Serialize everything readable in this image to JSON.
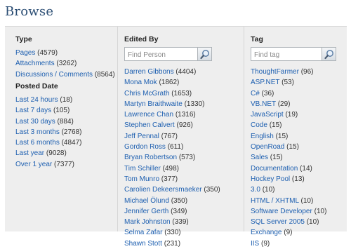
{
  "page": {
    "title": "Browse"
  },
  "type_section": {
    "header": "Type",
    "items": [
      {
        "label": "Pages",
        "count": "(4579)"
      },
      {
        "label": "Attachments",
        "count": "(3262)"
      },
      {
        "label": "Discussions / Comments",
        "count": "(8564)"
      }
    ]
  },
  "posted_date_section": {
    "header": "Posted Date",
    "items": [
      {
        "label": "Last 24 hours",
        "count": "(18)"
      },
      {
        "label": "Last 7 days",
        "count": "(105)"
      },
      {
        "label": "Last 30 days",
        "count": "(884)"
      },
      {
        "label": "Last 3 months",
        "count": "(2768)"
      },
      {
        "label": "Last 6 months",
        "count": "(4847)"
      },
      {
        "label": "Last year",
        "count": "(9028)"
      },
      {
        "label": "Over 1 year",
        "count": "(7377)"
      }
    ]
  },
  "edited_by_section": {
    "header": "Edited By",
    "search": {
      "placeholder": "Find Person",
      "button_icon": "magnifier-icon"
    },
    "items": [
      {
        "label": "Darren Gibbons",
        "count": "(4404)"
      },
      {
        "label": "Mona Mok",
        "count": "(1862)"
      },
      {
        "label": "Chris McGrath",
        "count": "(1653)"
      },
      {
        "label": "Martyn Braithwaite",
        "count": "(1330)"
      },
      {
        "label": "Lawrence Chan",
        "count": "(1316)"
      },
      {
        "label": "Stephen Calvert",
        "count": "(926)"
      },
      {
        "label": "Jeff Pennal",
        "count": "(767)"
      },
      {
        "label": "Gordon Ross",
        "count": "(611)"
      },
      {
        "label": "Bryan Robertson",
        "count": "(573)"
      },
      {
        "label": "Tim Schiller",
        "count": "(498)"
      },
      {
        "label": "Tom Munro",
        "count": "(377)"
      },
      {
        "label": "Carolien Dekeersmaeker",
        "count": "(350)"
      },
      {
        "label": "Michael Ölund",
        "count": "(350)"
      },
      {
        "label": "Jennifer Gerth",
        "count": "(349)"
      },
      {
        "label": "Mark Johnston",
        "count": "(339)"
      },
      {
        "label": "Selma Zafar",
        "count": "(330)"
      },
      {
        "label": "Shawn Stott",
        "count": "(231)"
      }
    ]
  },
  "tag_section": {
    "header": "Tag",
    "search": {
      "placeholder": "Find tag",
      "button_icon": "magnifier-icon"
    },
    "items": [
      {
        "label": "ThoughtFarmer",
        "count": "(96)"
      },
      {
        "label": "ASP.NET",
        "count": "(53)"
      },
      {
        "label": "C#",
        "count": "(36)"
      },
      {
        "label": "VB.NET",
        "count": "(29)"
      },
      {
        "label": "JavaScript",
        "count": "(19)"
      },
      {
        "label": "Code",
        "count": "(15)"
      },
      {
        "label": "English",
        "count": "(15)"
      },
      {
        "label": "OpenRoad",
        "count": "(15)"
      },
      {
        "label": "Sales",
        "count": "(15)"
      },
      {
        "label": "Documentation",
        "count": "(14)"
      },
      {
        "label": "Hockey Pool",
        "count": "(13)"
      },
      {
        "label": "3.0",
        "count": "(10)"
      },
      {
        "label": "HTML / XHTML",
        "count": "(10)"
      },
      {
        "label": "Software Developer",
        "count": "(10)"
      },
      {
        "label": "SQL Server 2005",
        "count": "(10)"
      },
      {
        "label": "Exchange",
        "count": "(9)"
      },
      {
        "label": "IIS",
        "count": "(9)"
      }
    ]
  },
  "colors": {
    "title": "#2c4e74",
    "link": "#1d5fb0",
    "panel_bg": "#eeeeee"
  }
}
